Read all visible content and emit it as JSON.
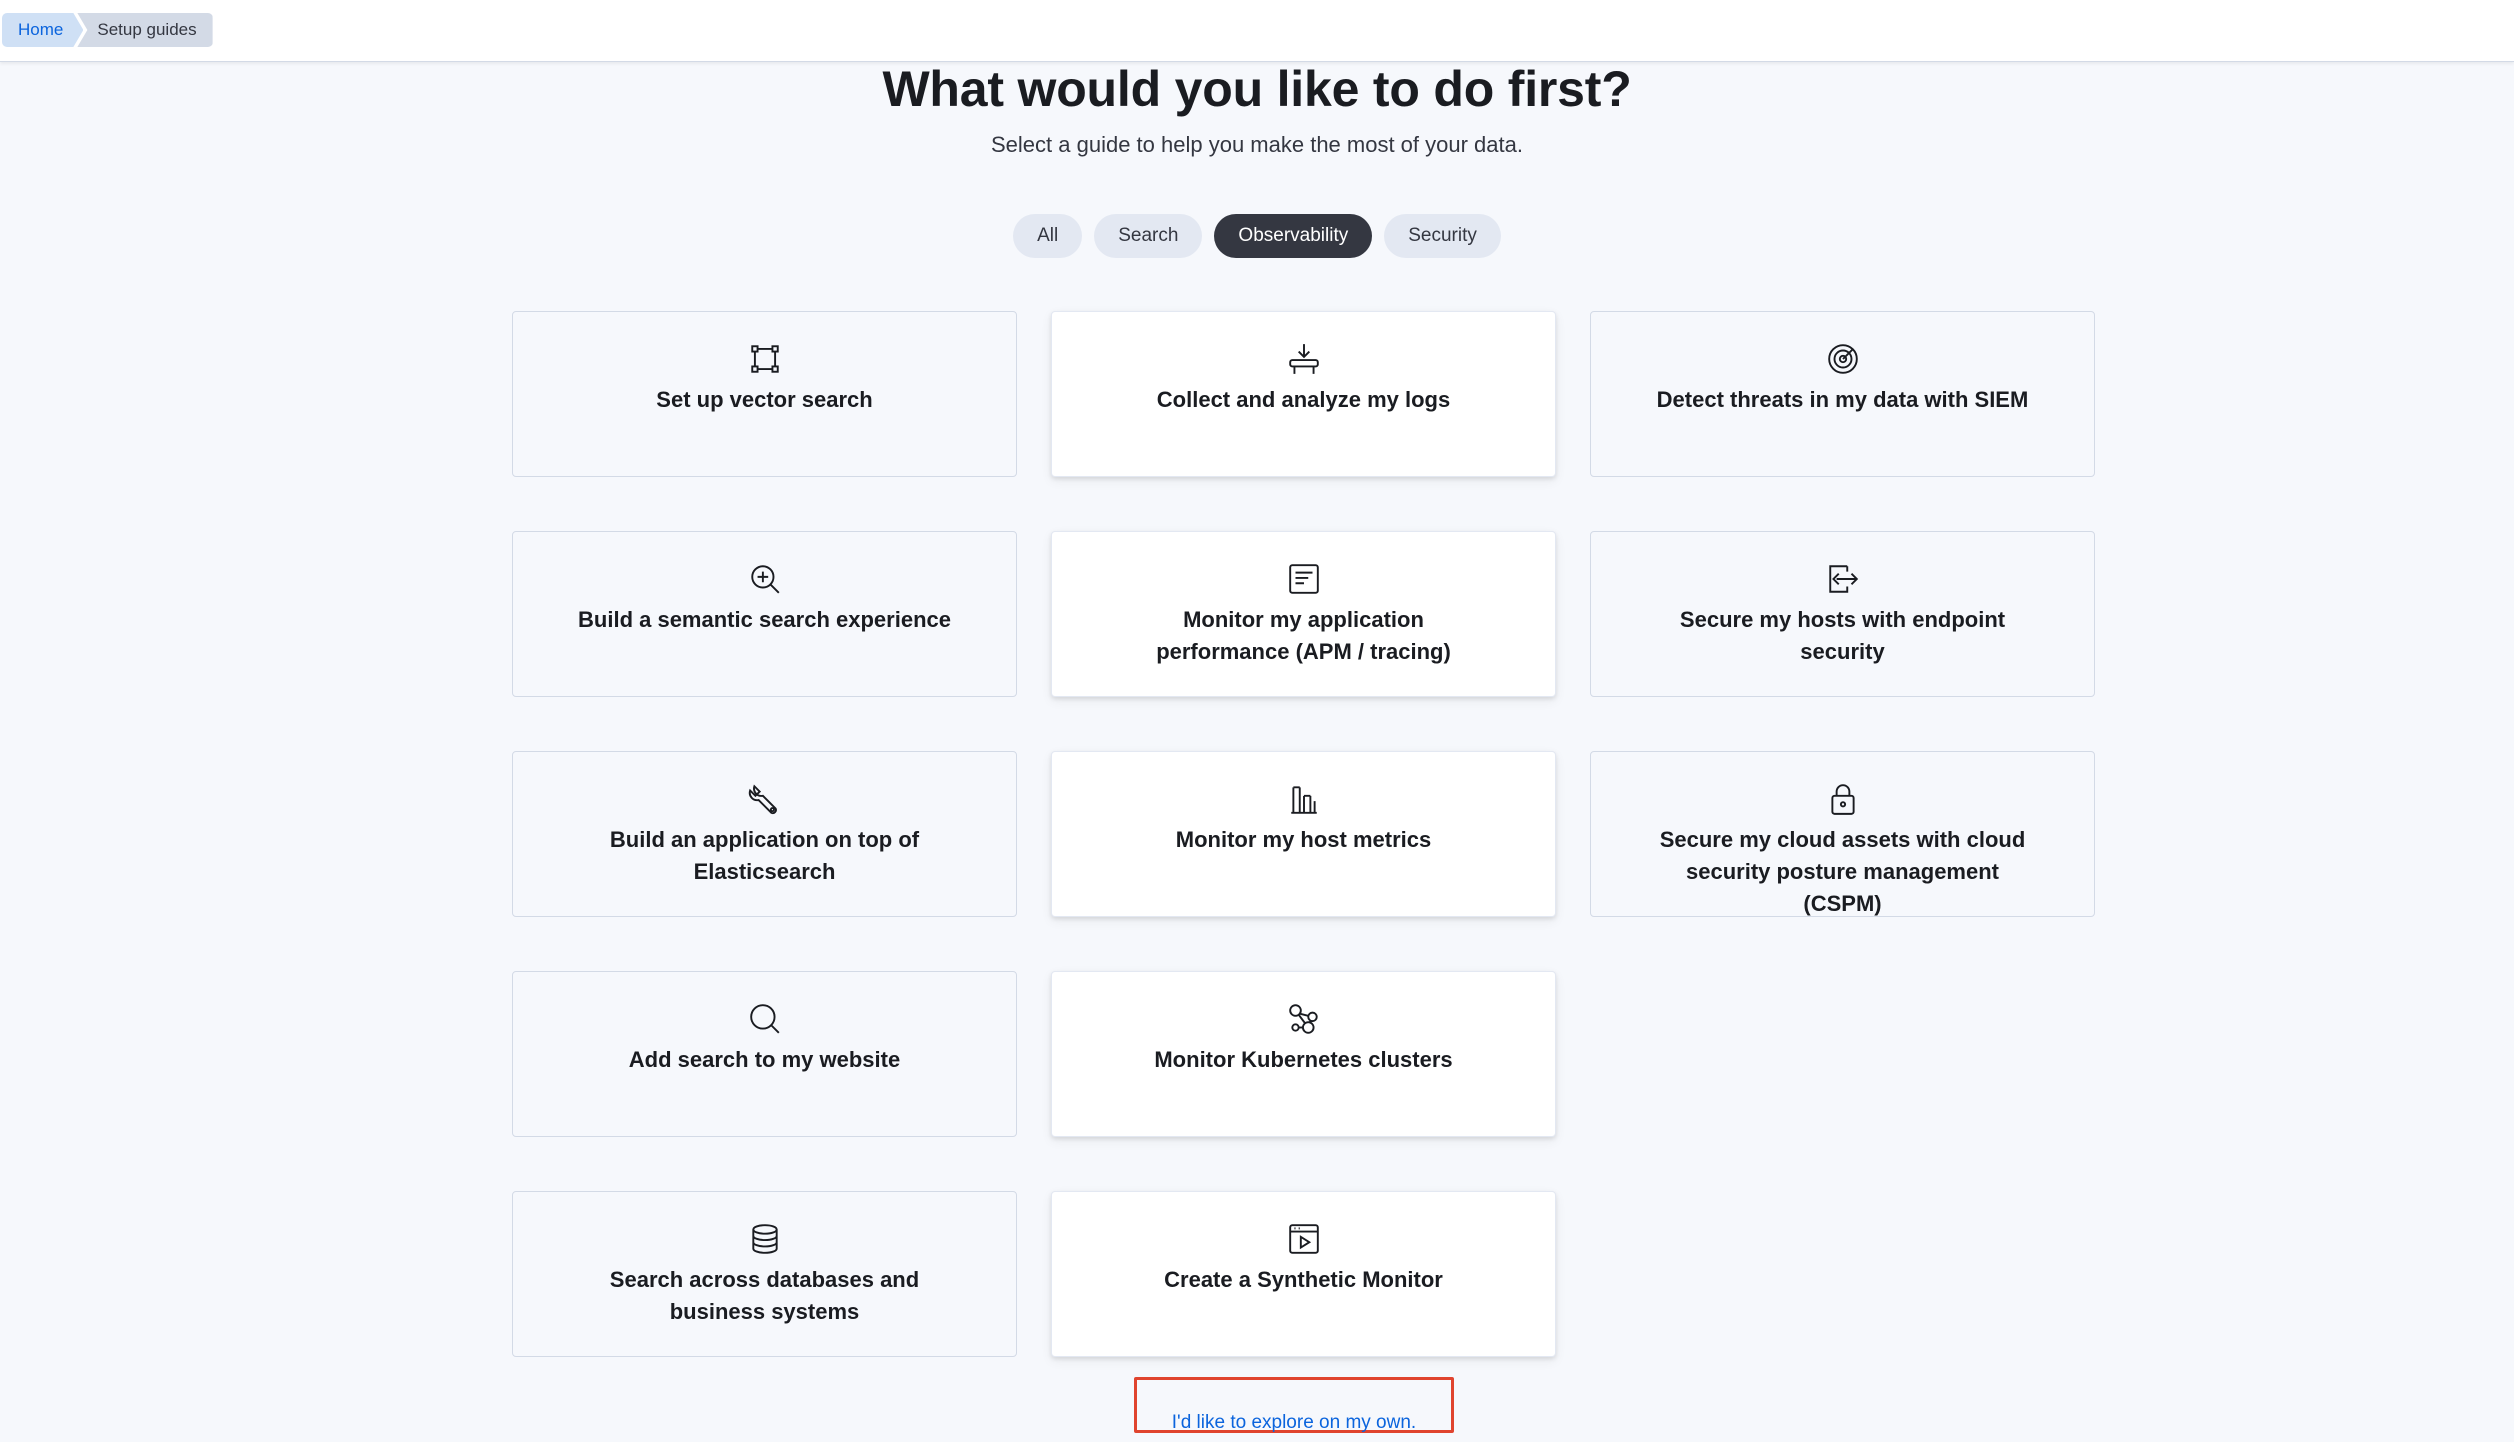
{
  "breadcrumb": {
    "home": "Home",
    "current": "Setup guides"
  },
  "header": {
    "title": "What would you like to do first?",
    "subtitle": "Select a guide to help you make the most of your data."
  },
  "filters": [
    {
      "label": "All",
      "active": false
    },
    {
      "label": "Search",
      "active": false
    },
    {
      "label": "Observability",
      "active": true
    },
    {
      "label": "Security",
      "active": false
    }
  ],
  "cards": {
    "vector_search": {
      "label": "Set up vector search",
      "icon": "vector-icon"
    },
    "logs": {
      "label": "Collect and analyze my logs",
      "icon": "log-ingest-icon"
    },
    "siem": {
      "label": "Detect threats in my data with SIEM",
      "icon": "radar-icon"
    },
    "semantic": {
      "label": "Build a semantic search experience",
      "icon": "zoom-in-icon"
    },
    "apm": {
      "label": "Monitor my application performance (APM / tracing)",
      "icon": "document-list-icon"
    },
    "endpoint": {
      "label": "Secure my hosts with endpoint security",
      "icon": "export-icon"
    },
    "app_es": {
      "label": "Build an application on top of Elasticsearch",
      "icon": "wrench-icon"
    },
    "host_metrics": {
      "label": "Monitor my host metrics",
      "icon": "metrics-icon"
    },
    "cspm": {
      "label": "Secure my cloud assets with cloud security posture management (CSPM)",
      "icon": "lock-icon"
    },
    "website_search": {
      "label": "Add search to my website",
      "icon": "search-icon"
    },
    "kubernetes": {
      "label": "Monitor Kubernetes clusters",
      "icon": "cluster-icon"
    },
    "databases": {
      "label": "Search across databases and business systems",
      "icon": "database-icon"
    },
    "synthetics": {
      "label": "Create a Synthetic Monitor",
      "icon": "video-player-icon"
    }
  },
  "explore_link": "I'd like to explore on my own.",
  "colors": {
    "accent": "#0b64dd",
    "active_pill": "#343741",
    "highlight_box": "#e0442f"
  }
}
